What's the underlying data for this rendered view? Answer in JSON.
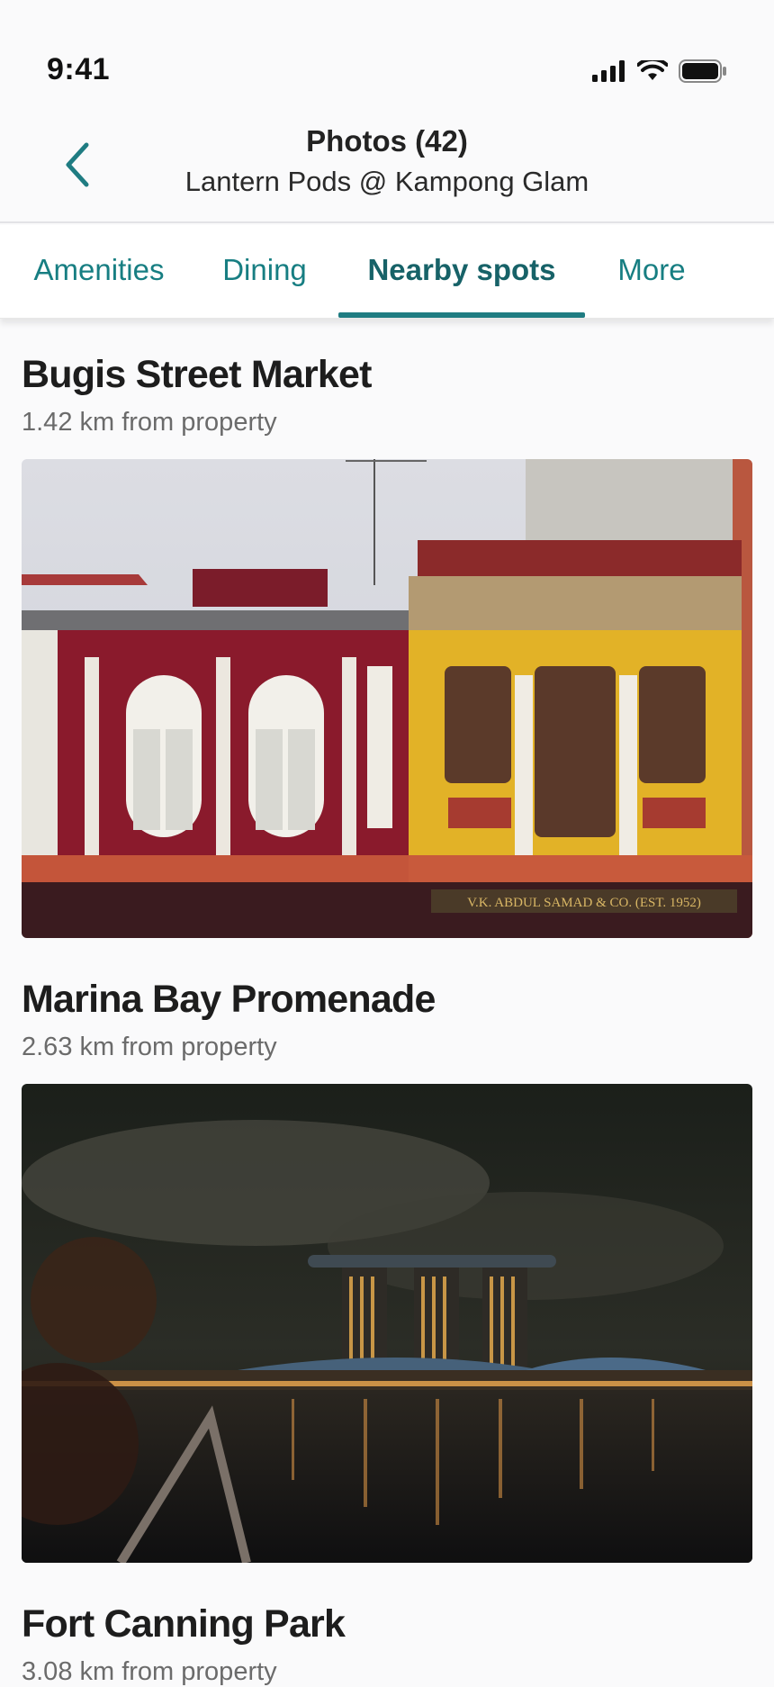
{
  "status_bar": {
    "time": "9:41"
  },
  "header": {
    "title": "Photos (42)",
    "subtitle": "Lantern Pods @ Kampong Glam"
  },
  "tabs": [
    {
      "label": "Amenities",
      "active": false
    },
    {
      "label": "Dining",
      "active": false
    },
    {
      "label": "Nearby spots",
      "active": true
    },
    {
      "label": "More",
      "active": false
    }
  ],
  "spots": [
    {
      "name": "Bugis Street Market",
      "distance": "1.42 km from property"
    },
    {
      "name": "Marina Bay Promenade",
      "distance": "2.63 km from property"
    },
    {
      "name": "Fort Canning Park",
      "distance": "3.08 km from property"
    }
  ],
  "colors": {
    "accent": "#177e82",
    "accent_dark": "#176268"
  },
  "shop_sign": "V.K. ABDUL SAMAD & CO. (EST. 1952)"
}
